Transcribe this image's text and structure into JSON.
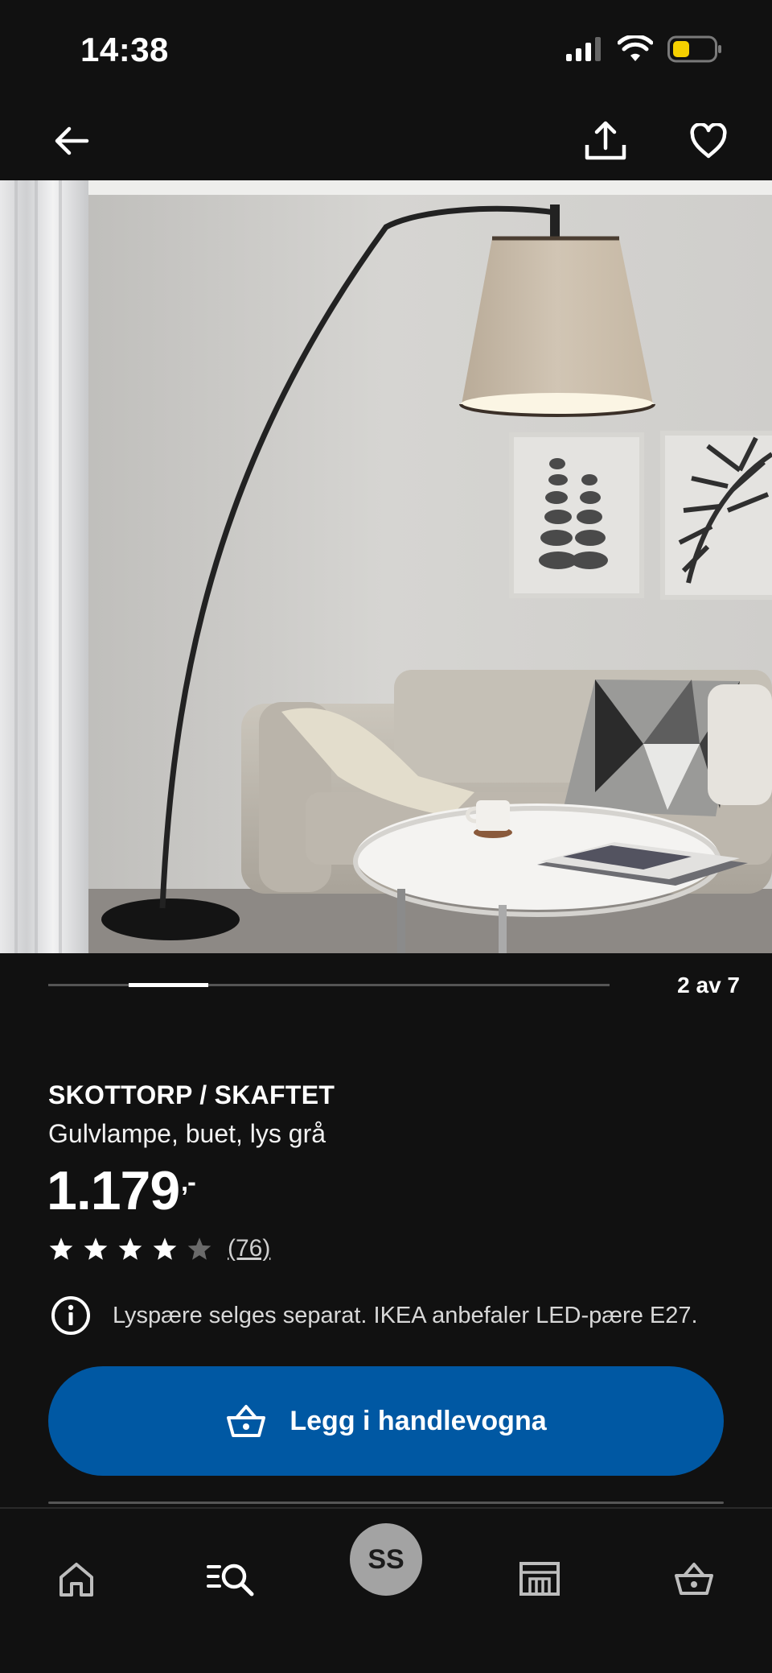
{
  "status_bar": {
    "time": "14:38"
  },
  "gallery": {
    "counter": "2 av 7",
    "current_index": 2,
    "total": 7
  },
  "product": {
    "name": "SKOTTORP / SKAFTET",
    "description": "Gulvlampe, buet, lys grå",
    "price": "1.179",
    "price_suffix": ",-",
    "rating": 4,
    "rating_max": 5,
    "review_count": "(76)",
    "info": "Lyspære selges separat. IKEA anbefaler LED-pære E27."
  },
  "actions": {
    "add_to_cart": "Legg i handlevogna"
  },
  "bottom_nav": {
    "avatar_initials": "SS"
  },
  "colors": {
    "background": "#111111",
    "primary_button": "#0058a3",
    "battery": "#f5d000"
  }
}
